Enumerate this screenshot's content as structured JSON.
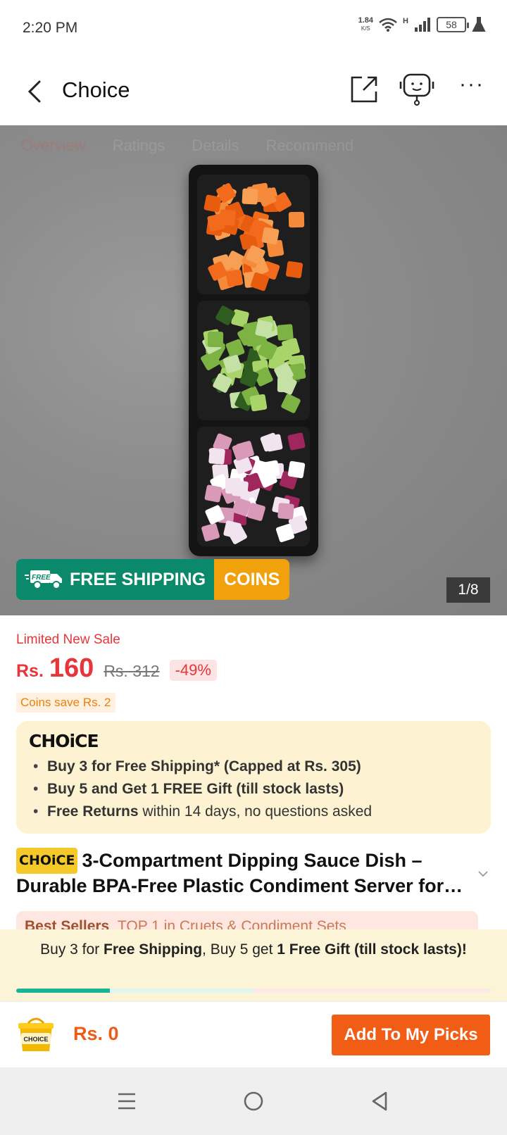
{
  "status_bar": {
    "time": "2:20 PM",
    "net_speed_value": "1.84",
    "net_speed_unit": "K/S",
    "network_type": "H",
    "battery_level": "58",
    "icons": [
      "wifi-icon",
      "signal-icon",
      "battery-icon",
      "flask-icon"
    ]
  },
  "header": {
    "title": "Choice",
    "icons": [
      "back-icon",
      "share-icon",
      "support-bot-icon",
      "more-icon"
    ]
  },
  "hero": {
    "faded_tabs": [
      "Overview",
      "Ratings",
      "Details",
      "Recommend"
    ],
    "free_shipping_badge": "FREE SHIPPING",
    "free_tag": "FREE",
    "coins_badge": "COINS",
    "image_counter": "1/8"
  },
  "pricing": {
    "sale_label": "Limited New Sale",
    "currency": "Rs.",
    "price": "160",
    "original_price": "Rs. 312",
    "discount": "-49%",
    "coins_save": "Coins save Rs. 2"
  },
  "choice_card": {
    "logo": "CHOiCE",
    "benefit_1_bold": "Buy 3 for  Free Shipping* (Capped at Rs. 305)",
    "benefit_2_bold": "Buy 5 and Get 1 FREE Gift (till stock lasts)",
    "benefit_3_bold": "Free Returns",
    "benefit_3_rest": " within 14 days, no questions asked"
  },
  "product": {
    "badge": "CHOiCE",
    "title_line_1": "3-Compartment Dipping Sauce Dish –",
    "title_line_2": "Durable BPA-Free Plastic Condiment Server for Parties"
  },
  "bestseller": {
    "label": "Best Sellers",
    "rank": "TOP 1 in Cruets & Condiment Sets"
  },
  "promo": {
    "part_1": "Buy 3 for ",
    "part_2": "Free Shipping",
    "part_3": ", Buy 5 get ",
    "part_4": "1 Free Gift (till stock lasts)!",
    "progress_fraction": 0.197
  },
  "action_bar": {
    "cart_badge": "CHOICE",
    "cart_total": "Rs. 0",
    "add_button": "Add To My Picks"
  },
  "colors": {
    "accent_red": "#e8353a",
    "action_orange": "#f25d15",
    "free_shipping_green": "#0a8a6a",
    "coins_orange": "#f0a10c",
    "choice_card_bg": "#fdf3d2",
    "progress_teal": "#1ab394"
  }
}
